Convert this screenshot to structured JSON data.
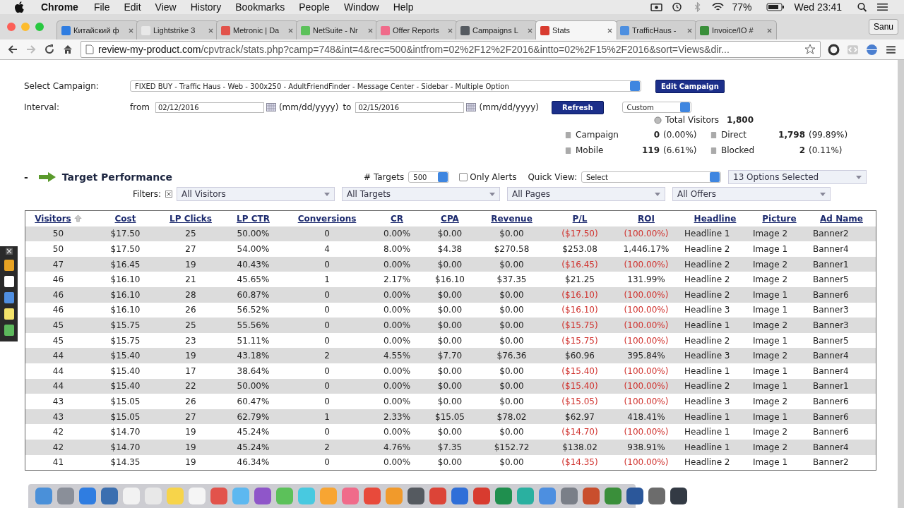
{
  "menubar": {
    "app": "Chrome",
    "menus": [
      "File",
      "Edit",
      "View",
      "History",
      "Bookmarks",
      "People",
      "Window",
      "Help"
    ],
    "battery": "77%",
    "clock": "Wed 23:41"
  },
  "tabs": [
    {
      "title": "Китайский ф",
      "selected": false
    },
    {
      "title": "Lightstrike 3",
      "selected": false
    },
    {
      "title": "Metronic | Da",
      "selected": false
    },
    {
      "title": "NetSuite - Nr",
      "selected": false
    },
    {
      "title": "Offer Reports",
      "selected": false
    },
    {
      "title": "Campaigns L",
      "selected": false
    },
    {
      "title": "Stats",
      "selected": true
    },
    {
      "title": "TrafficHaus -",
      "selected": false
    },
    {
      "title": "Invoice/IO #",
      "selected": false
    }
  ],
  "profile": "Sanu",
  "address": {
    "host": "review-my-product.com",
    "path": "/cpvtrack/stats.php?camp=748&int=4&rec=500&intfrom=02%2F12%2F2016&intto=02%2F15%2F2016&sort=Views&dir..."
  },
  "form": {
    "campaign_label": "Select Campaign:",
    "campaign": "FIXED BUY - Traffic Haus - Web - 300x250 - AdultFriendFinder - Message Center - Sidebar  -  Multiple Option",
    "edit_button": "Edit Campaign",
    "interval_label": "Interval:",
    "from_label": "from",
    "from": "02/12/2016",
    "from_format": "(mm/dd/yyyy)",
    "to_label": "to",
    "to": "02/15/2016",
    "to_format": "(mm/dd/yyyy)",
    "refresh_button": "Refresh",
    "preset": "Custom"
  },
  "stats": {
    "total_label": "Total Visitors",
    "total": "1,800",
    "items": [
      {
        "label": "Campaign",
        "value": "0",
        "pct": "(0.00%)"
      },
      {
        "label": "Direct",
        "value": "1,798",
        "pct": "(99.89%)"
      },
      {
        "label": "Mobile",
        "value": "119",
        "pct": "(6.61%)"
      },
      {
        "label": "Blocked",
        "value": "2",
        "pct": "(0.11%)"
      }
    ]
  },
  "section": {
    "collapse": "-",
    "title": "Target Performance",
    "targets_label": "# Targets",
    "targets": "500",
    "only_alerts": {
      "label": "Only Alerts",
      "checked": false
    },
    "quick_view_label": "Quick View:",
    "quick_view": "Select",
    "options": "13 Options Selected",
    "filters_label": "Filters:",
    "filters": [
      "All Visitors",
      "All Targets",
      "All Pages",
      "All Offers"
    ]
  },
  "table": {
    "columns": [
      {
        "label": "Visitors",
        "sorted": true
      },
      {
        "label": "Cost",
        "sorted": false
      },
      {
        "label": "LP Clicks",
        "sorted": false
      },
      {
        "label": "LP CTR",
        "sorted": false
      },
      {
        "label": "Conversions",
        "sorted": false
      },
      {
        "label": "CR",
        "sorted": false
      },
      {
        "label": "CPA",
        "sorted": false
      },
      {
        "label": "Revenue",
        "sorted": false
      },
      {
        "label": "P/L",
        "sorted": false
      },
      {
        "label": "ROI",
        "sorted": false
      },
      {
        "label": "Headline",
        "sorted": false
      },
      {
        "label": "Picture",
        "sorted": false
      },
      {
        "label": "Ad Name",
        "sorted": false
      }
    ],
    "rows": [
      {
        "loss": true,
        "cells": [
          "50",
          "$17.50",
          "25",
          "50.00%",
          "0",
          "0.00%",
          "$0.00",
          "$0.00",
          "($17.50)",
          "(100.00%)",
          "Headline 1",
          "Image 2",
          "Banner2"
        ]
      },
      {
        "loss": false,
        "cells": [
          "50",
          "$17.50",
          "27",
          "54.00%",
          "4",
          "8.00%",
          "$4.38",
          "$270.58",
          "$253.08",
          "1,446.17%",
          "Headline 2",
          "Image 1",
          "Banner4"
        ]
      },
      {
        "loss": true,
        "cells": [
          "47",
          "$16.45",
          "19",
          "40.43%",
          "0",
          "0.00%",
          "$0.00",
          "$0.00",
          "($16.45)",
          "(100.00%)",
          "Headline 2",
          "Image 2",
          "Banner1"
        ]
      },
      {
        "loss": false,
        "cells": [
          "46",
          "$16.10",
          "21",
          "45.65%",
          "1",
          "2.17%",
          "$16.10",
          "$37.35",
          "$21.25",
          "131.99%",
          "Headline 2",
          "Image 2",
          "Banner5"
        ]
      },
      {
        "loss": true,
        "cells": [
          "46",
          "$16.10",
          "28",
          "60.87%",
          "0",
          "0.00%",
          "$0.00",
          "$0.00",
          "($16.10)",
          "(100.00%)",
          "Headline 2",
          "Image 1",
          "Banner6"
        ]
      },
      {
        "loss": true,
        "cells": [
          "46",
          "$16.10",
          "26",
          "56.52%",
          "0",
          "0.00%",
          "$0.00",
          "$0.00",
          "($16.10)",
          "(100.00%)",
          "Headline 3",
          "Image 1",
          "Banner3"
        ]
      },
      {
        "loss": true,
        "cells": [
          "45",
          "$15.75",
          "25",
          "55.56%",
          "0",
          "0.00%",
          "$0.00",
          "$0.00",
          "($15.75)",
          "(100.00%)",
          "Headline 1",
          "Image 2",
          "Banner3"
        ]
      },
      {
        "loss": true,
        "cells": [
          "45",
          "$15.75",
          "23",
          "51.11%",
          "0",
          "0.00%",
          "$0.00",
          "$0.00",
          "($15.75)",
          "(100.00%)",
          "Headline 2",
          "Image 1",
          "Banner5"
        ]
      },
      {
        "loss": false,
        "cells": [
          "44",
          "$15.40",
          "19",
          "43.18%",
          "2",
          "4.55%",
          "$7.70",
          "$76.36",
          "$60.96",
          "395.84%",
          "Headline 3",
          "Image 2",
          "Banner4"
        ]
      },
      {
        "loss": true,
        "cells": [
          "44",
          "$15.40",
          "17",
          "38.64%",
          "0",
          "0.00%",
          "$0.00",
          "$0.00",
          "($15.40)",
          "(100.00%)",
          "Headline 1",
          "Image 1",
          "Banner4"
        ]
      },
      {
        "loss": true,
        "cells": [
          "44",
          "$15.40",
          "22",
          "50.00%",
          "0",
          "0.00%",
          "$0.00",
          "$0.00",
          "($15.40)",
          "(100.00%)",
          "Headline 2",
          "Image 1",
          "Banner1"
        ]
      },
      {
        "loss": true,
        "cells": [
          "43",
          "$15.05",
          "26",
          "60.47%",
          "0",
          "0.00%",
          "$0.00",
          "$0.00",
          "($15.05)",
          "(100.00%)",
          "Headline 3",
          "Image 2",
          "Banner6"
        ]
      },
      {
        "loss": false,
        "cells": [
          "43",
          "$15.05",
          "27",
          "62.79%",
          "1",
          "2.33%",
          "$15.05",
          "$78.02",
          "$62.97",
          "418.41%",
          "Headline 1",
          "Image 1",
          "Banner6"
        ]
      },
      {
        "loss": true,
        "cells": [
          "42",
          "$14.70",
          "19",
          "45.24%",
          "0",
          "0.00%",
          "$0.00",
          "$0.00",
          "($14.70)",
          "(100.00%)",
          "Headline 1",
          "Image 2",
          "Banner6"
        ]
      },
      {
        "loss": false,
        "cells": [
          "42",
          "$14.70",
          "19",
          "45.24%",
          "2",
          "4.76%",
          "$7.35",
          "$152.72",
          "$138.02",
          "938.91%",
          "Headline 1",
          "Image 2",
          "Banner4"
        ]
      },
      {
        "loss": true,
        "cells": [
          "41",
          "$14.35",
          "19",
          "46.34%",
          "0",
          "0.00%",
          "$0.00",
          "$0.00",
          "($14.35)",
          "(100.00%)",
          "Headline 2",
          "Image 1",
          "Banner2"
        ]
      }
    ]
  }
}
